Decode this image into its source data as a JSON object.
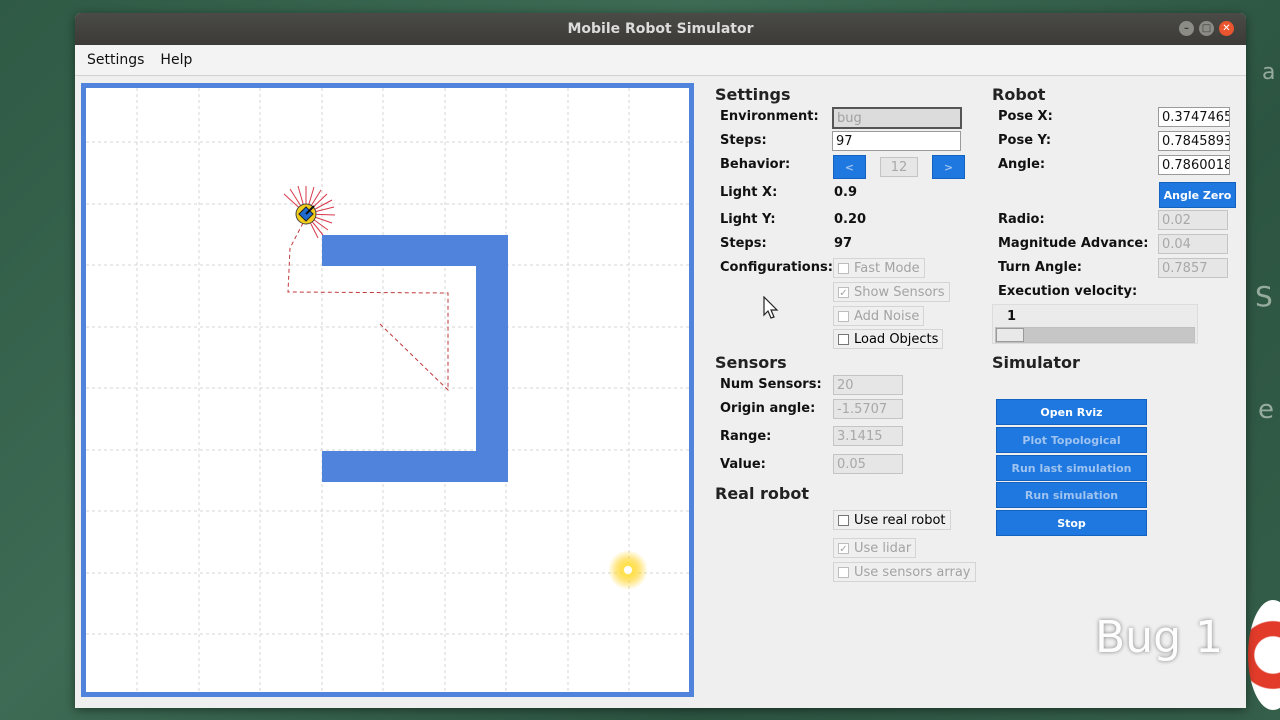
{
  "window": {
    "title": "Mobile Robot Simulator"
  },
  "menu": {
    "items": [
      "Settings",
      "Help"
    ]
  },
  "overlay": {
    "label": "Bug 1"
  },
  "settings": {
    "heading": "Settings",
    "environment_label": "Environment:",
    "environment_value": "bug",
    "steps_label": "Steps:",
    "steps_value": "97",
    "behavior_label": "Behavior:",
    "behavior_prev": "<",
    "behavior_value": "12",
    "behavior_next": ">",
    "light_x_label": "Light X:",
    "light_x_value": "0.9",
    "light_y_label": "Light Y:",
    "light_y_value": "0.20",
    "steps2_label": "Steps:",
    "steps2_value": "97",
    "configurations_label": "Configurations:",
    "fast_mode": "Fast Mode",
    "show_sensors": "Show Sensors",
    "add_noise": "Add Noise",
    "load_objects": "Load Objects"
  },
  "sensors": {
    "heading": "Sensors",
    "num_label": "Num Sensors:",
    "num_value": "20",
    "origin_label": "Origin angle:",
    "origin_value": "-1.5707",
    "range_label": "Range:",
    "range_value": "3.1415",
    "value_label": "Value:",
    "value_value": "0.05"
  },
  "real_robot": {
    "heading": "Real robot",
    "use_real_robot": "Use real robot",
    "use_lidar": "Use lidar",
    "use_sensors_array": "Use sensors array"
  },
  "robot": {
    "heading": "Robot",
    "pose_x_label": "Pose X:",
    "pose_x_value": "0.3747465",
    "pose_y_label": "Pose Y:",
    "pose_y_value": "0.7845893",
    "angle_label": "Angle:",
    "angle_value": "0.7860018",
    "angle_zero_button": "Angle Zero",
    "radio_label": "Radio:",
    "radio_value": "0.02",
    "magnitude_label": "Magnitude Advance:",
    "magnitude_value": "0.04",
    "turn_label": "Turn Angle:",
    "turn_value": "0.7857",
    "velocity_label": "Execution velocity:",
    "velocity_value": "1"
  },
  "simulator": {
    "heading": "Simulator",
    "open_rviz": "Open Rviz",
    "plot_topological": "Plot Topological",
    "run_last": "Run last simulation",
    "run_sim": "Run simulation",
    "stop": "Stop"
  },
  "colors": {
    "obstacle": "#4f83dc",
    "button": "#1e78e0",
    "trail": "#c0393b",
    "light": "#ffd21f"
  }
}
